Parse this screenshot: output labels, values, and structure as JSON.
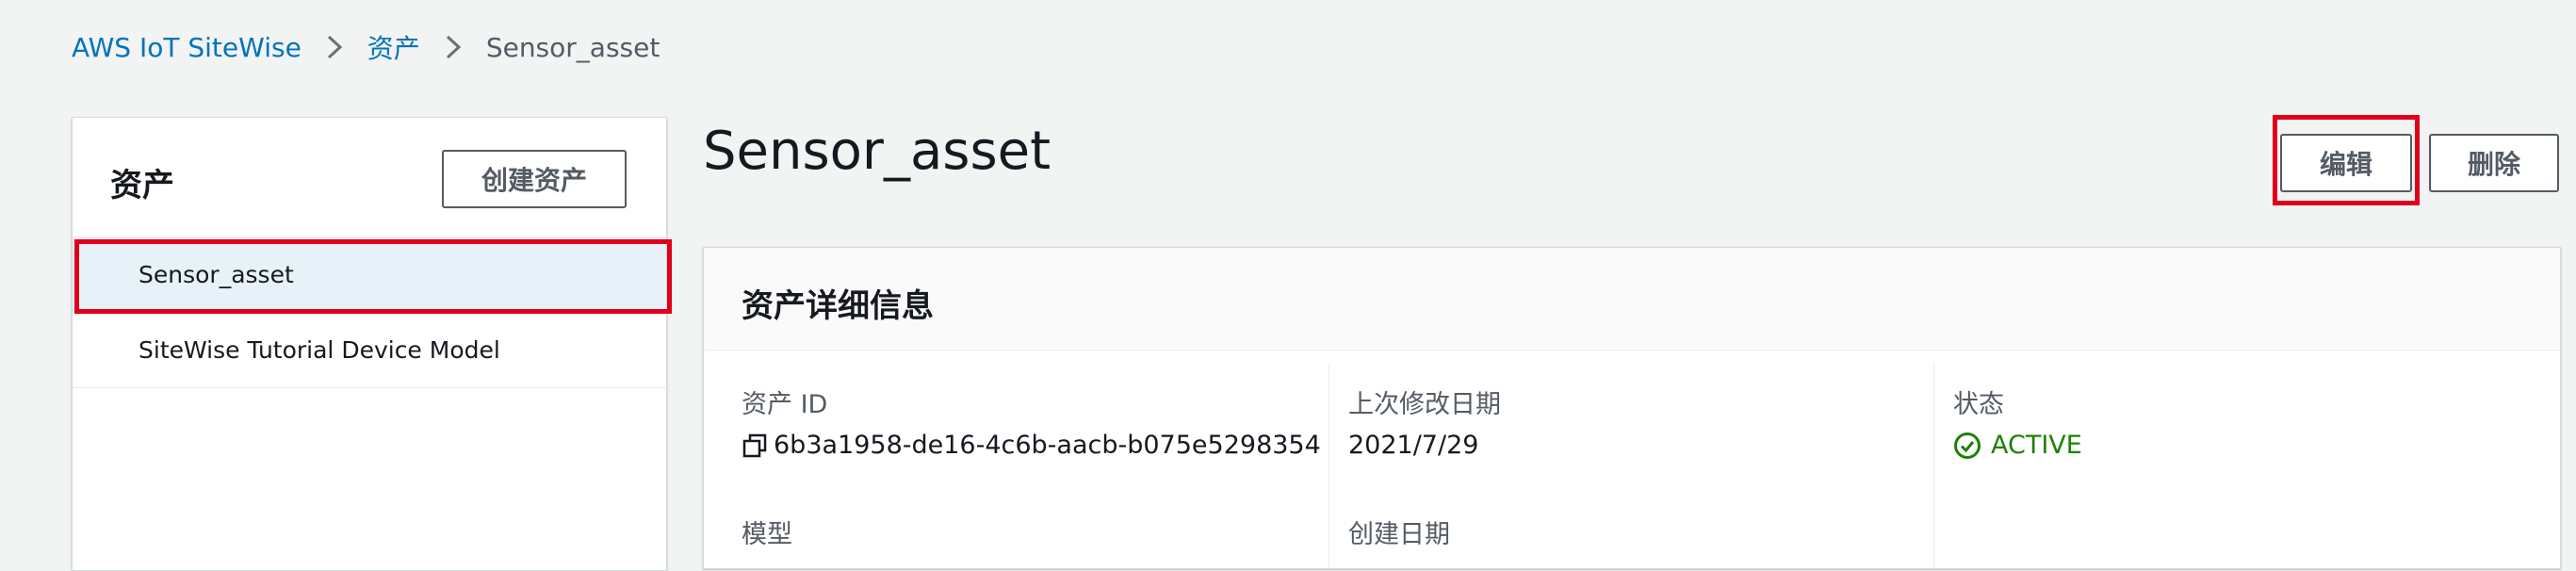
{
  "breadcrumb": {
    "root": "AWS IoT SiteWise",
    "level1": "资产",
    "current": "Sensor_asset"
  },
  "sidebar": {
    "title": "资产",
    "create_button": "创建资产",
    "items": [
      {
        "label": "Sensor_asset",
        "selected": true
      },
      {
        "label": "SiteWise Tutorial Device Model",
        "selected": false
      }
    ]
  },
  "page": {
    "title": "Sensor_asset",
    "edit_button": "编辑",
    "delete_button": "删除"
  },
  "details": {
    "title": "资产详细信息",
    "asset_id_label": "资产 ID",
    "asset_id_value": "6b3a1958-de16-4c6b-aacb-b075e5298354",
    "last_modified_label": "上次修改日期",
    "last_modified_value": "2021/7/29",
    "status_label": "状态",
    "status_value": "ACTIVE",
    "model_label": "模型",
    "created_label": "创建日期"
  },
  "colors": {
    "link": "#0073bb",
    "status_active": "#1d8102",
    "highlight": "#e0001b",
    "selected_row": "#e6f1f8"
  },
  "icons": {
    "separator": "chevron-right-icon",
    "copy": "copy-icon",
    "status": "check-circle-icon"
  }
}
